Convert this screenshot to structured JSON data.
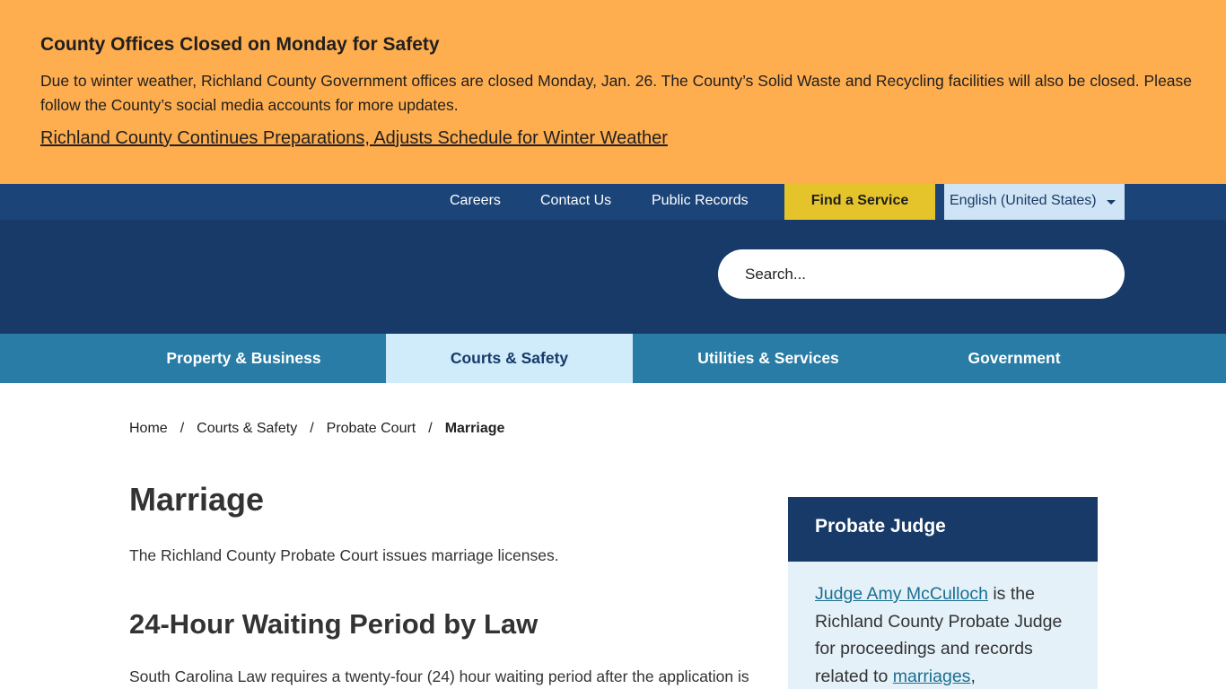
{
  "alert": {
    "title": "County Offices Closed on Monday for Safety",
    "body": "Due to winter weather, Richland County Government offices are closed Monday, Jan. 26. The County’s Solid Waste and Recycling facilities will also be closed. Please follow the County’s social media accounts for more updates.",
    "link": "Richland County Continues Preparations, Adjusts Schedule for Winter Weather"
  },
  "utility_nav": {
    "careers": "Careers",
    "contact": "Contact Us",
    "records": "Public Records",
    "find_service": "Find a Service",
    "language": "English (United States)"
  },
  "search": {
    "placeholder": "Search..."
  },
  "main_nav": {
    "items": [
      {
        "label": "Property & Business",
        "active": false
      },
      {
        "label": "Courts & Safety",
        "active": true
      },
      {
        "label": "Utilities & Services",
        "active": false
      },
      {
        "label": "Government",
        "active": false
      }
    ]
  },
  "breadcrumb": {
    "items": [
      "Home",
      "Courts & Safety",
      "Probate Court"
    ],
    "current": "Marriage",
    "separator": "/"
  },
  "content": {
    "title": "Marriage",
    "intro": "The Richland County Probate Court issues marriage licenses.",
    "heading2": "24-Hour Waiting Period by Law",
    "paragraph2": "South Carolina Law requires a twenty-four (24) hour waiting period after the application is"
  },
  "sidebar": {
    "title": "Probate Judge",
    "judge_link": "Judge Amy McCulloch",
    "text_1": " is the Richland County Probate Judge for proceedings and records related to ",
    "marriages_link": "marriages",
    "text_2": ","
  },
  "colors": {
    "alert_bg": "#fead4f",
    "utility_bg": "#1b4479",
    "header_bg": "#173a69",
    "nav_bg": "#287ca5",
    "nav_active_bg": "#d0ebfa",
    "find_button_bg": "#e5c42b",
    "sidebar_bg": "#e4f1f9",
    "link": "#1a6f92"
  }
}
